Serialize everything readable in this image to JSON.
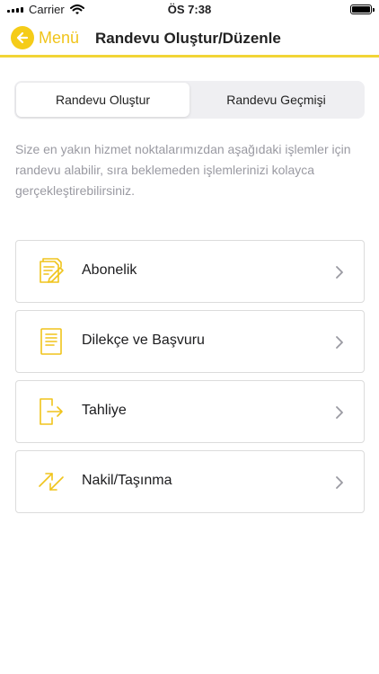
{
  "status_bar": {
    "carrier": "Carrier",
    "time": "ÖS 7:38"
  },
  "nav": {
    "back_label": "Menü",
    "title": "Randevu Oluştur/Düzenle"
  },
  "tabs": [
    {
      "label": "Randevu Oluştur",
      "active": true
    },
    {
      "label": "Randevu Geçmişi",
      "active": false
    }
  ],
  "description": "Size en yakın hizmet noktalarımızdan aşağıdaki işlemler için randevu alabilir, sıra beklemeden işlemlerinizi kolayca gerçekleştirebilirsiniz.",
  "menu": [
    {
      "label": "Abonelik",
      "icon": "contract-pen-icon"
    },
    {
      "label": "Dilekçe ve Başvuru",
      "icon": "document-icon"
    },
    {
      "label": "Tahliye",
      "icon": "exit-icon"
    },
    {
      "label": "Nakil/Taşınma",
      "icon": "transfer-arrows-icon"
    }
  ],
  "colors": {
    "accent": "#f5cc18",
    "icon": "#f0c41b",
    "muted_text": "#9a9aa2"
  }
}
